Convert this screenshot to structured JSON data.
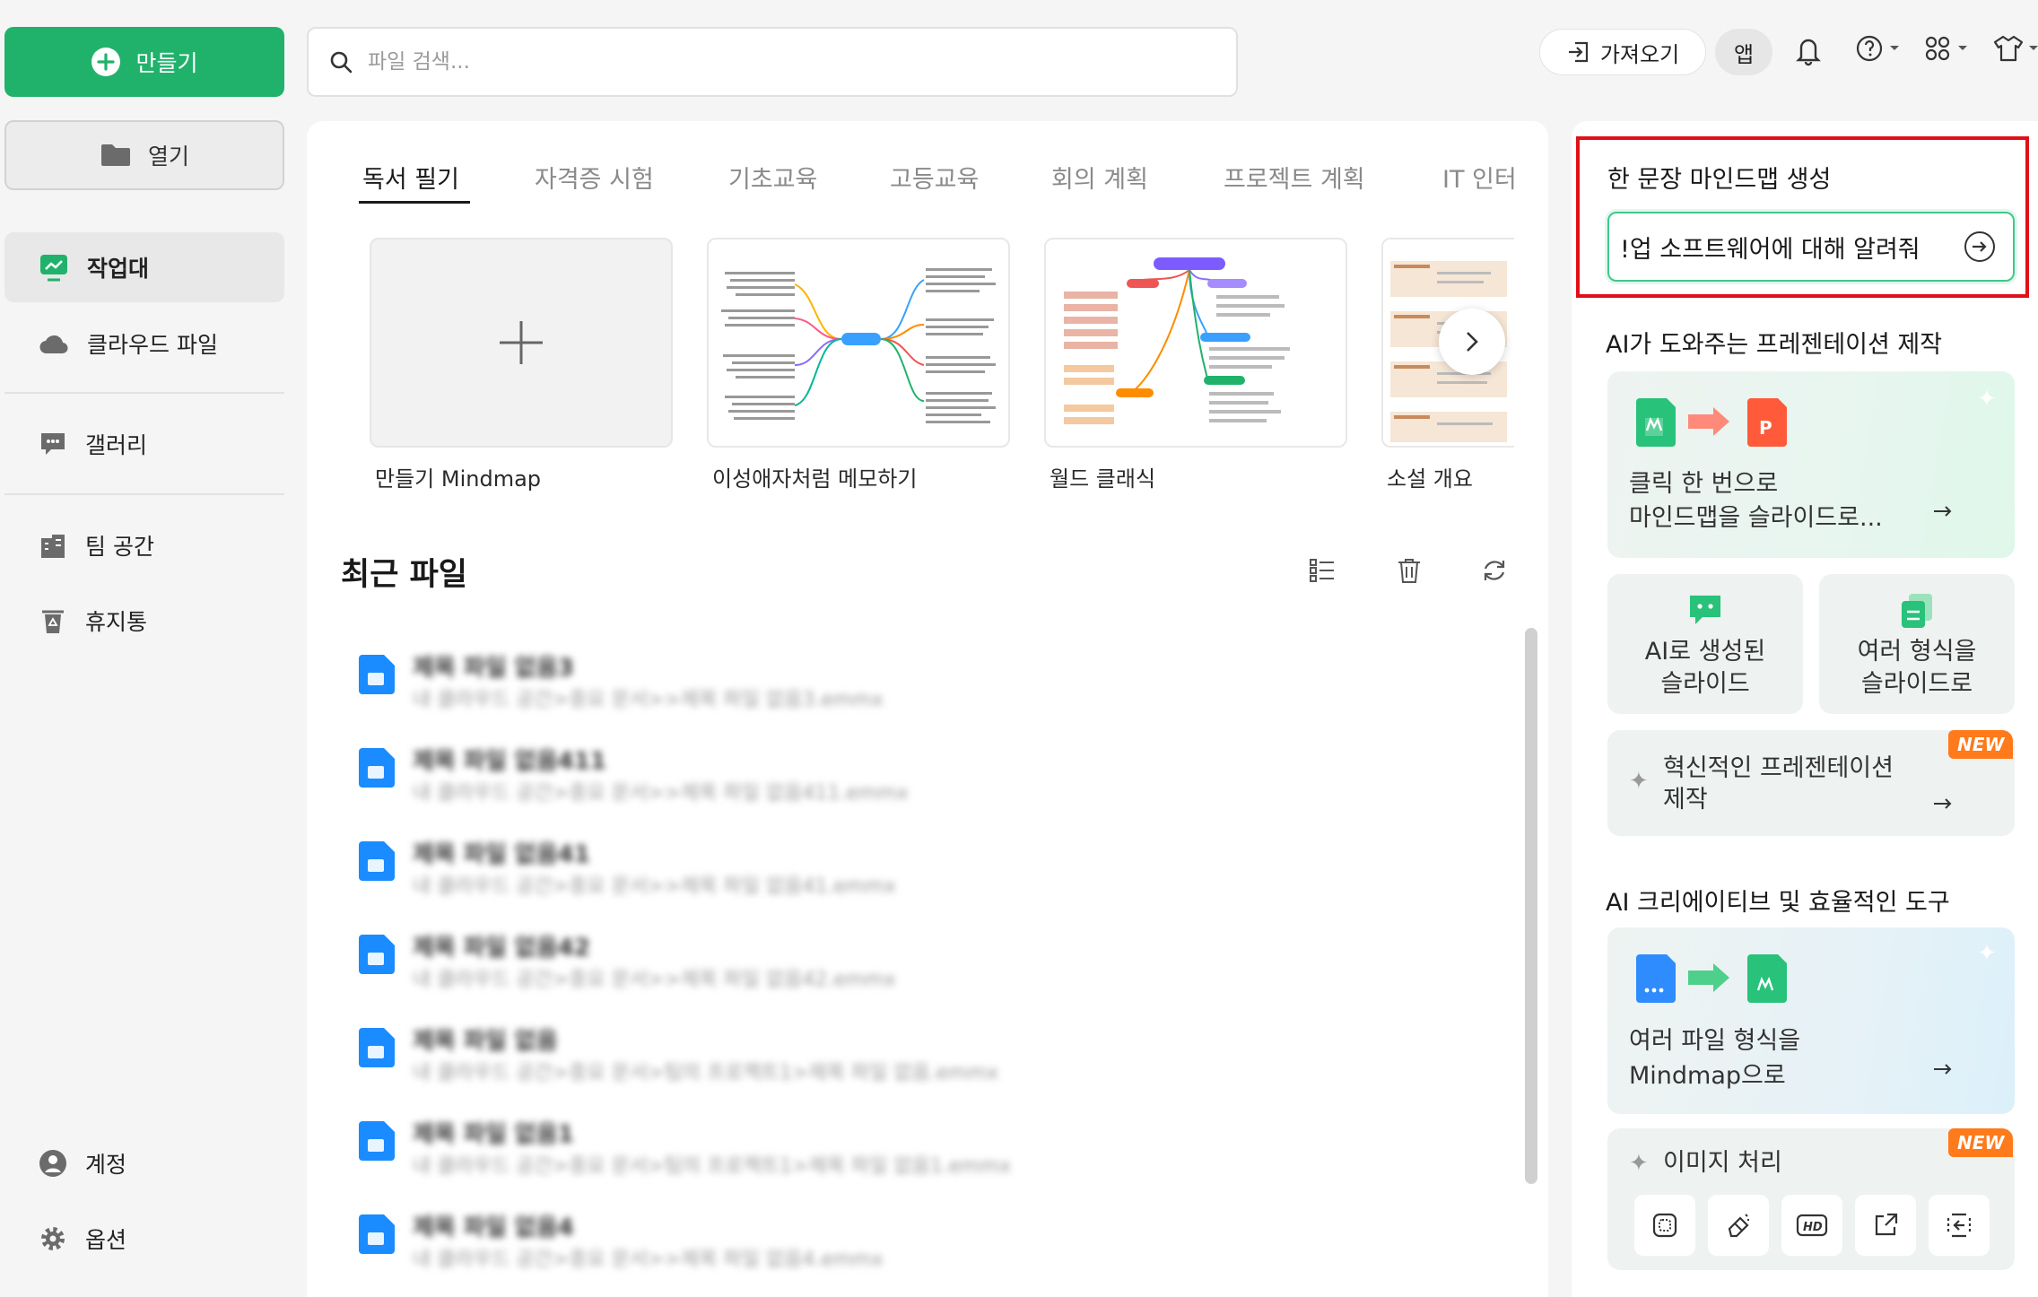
{
  "sidebar": {
    "create_label": "만들기",
    "open_label": "열기",
    "items": [
      {
        "label": "작업대"
      },
      {
        "label": "클라우드 파일"
      },
      {
        "label": "갤러리"
      },
      {
        "label": "팀 공간"
      },
      {
        "label": "휴지통"
      }
    ],
    "bottom": [
      {
        "label": "계정"
      },
      {
        "label": "옵션"
      }
    ]
  },
  "topbar": {
    "search_placeholder": "파일 검색...",
    "import_label": "가져오기",
    "app_label": "앱"
  },
  "templates": {
    "tabs": [
      "독서 필기",
      "자격증 시험",
      "기초교육",
      "고등교육",
      "회의 계획",
      "프로젝트 계획",
      "IT 인터"
    ],
    "cards": [
      {
        "label": "만들기 Mindmap"
      },
      {
        "label": "이성애자처럼 메모하기"
      },
      {
        "label": "월드 클래식"
      },
      {
        "label": "소설 개요"
      }
    ]
  },
  "recent": {
    "title": "최근 파일",
    "files": [
      {
        "name": "제목 파일 없음3",
        "path": "내 클라우드 공간>중요 문서>>제목 파일 없음3.emmx"
      },
      {
        "name": "제목 파일 없음411",
        "path": "내 클라우드 공간>중요 문서>>제목 파일 없음411.emmx"
      },
      {
        "name": "제목 파일 없음41",
        "path": "내 클라우드 공간>중요 문서>>제목 파일 없음41.emmx"
      },
      {
        "name": "제목 파일 없음42",
        "path": "내 클라우드 공간>중요 문서>>제목 파일 없음42.emmx"
      },
      {
        "name": "제목 파일 없음",
        "path": "내 클라우드 공간>중요 문서>팀의 프로젝트1>제목 파일 없음.emmx"
      },
      {
        "name": "제목 파일 없음1",
        "path": "내 클라우드 공간>중요 문서>팀의 프로젝트1>제목 파일 없음1.emmx"
      },
      {
        "name": "제목 파일 없음4",
        "path": "내 클라우드 공간>중요 문서>>제목 파일 없음4.emmx"
      }
    ]
  },
  "ai_panel": {
    "one_sentence_title": "한 문장 마인드맵 생성",
    "prompt_text": "!업 소프트웨어에 대해 알려줘",
    "presentation_title": "AI가 도와주는 프레젠테이션 제작",
    "mindmap_to_slides": [
      "클릭 한 번으로",
      "마인드맵을 슬라이드로..."
    ],
    "ai_slides": [
      "AI로 생성된",
      "슬라이드"
    ],
    "formats_to_slides": [
      "여러 형식을",
      "슬라이드로"
    ],
    "innovative": [
      "혁신적인 프레젠테이션",
      "제작"
    ],
    "new_badge": "NEW",
    "tools_title": "AI 크리에이티브 및 효율적인 도구",
    "files_to_mindmap": [
      "여러 파일 형식을",
      "Mindmap으로"
    ],
    "image_processing": "이미지 처리",
    "image_tools": [
      "hd-icon"
    ]
  },
  "colors": {
    "brand_green": "#20b26b",
    "highlight_red": "#e0101a",
    "new_orange": "#ff7a1a",
    "file_blue": "#1a8cff"
  }
}
